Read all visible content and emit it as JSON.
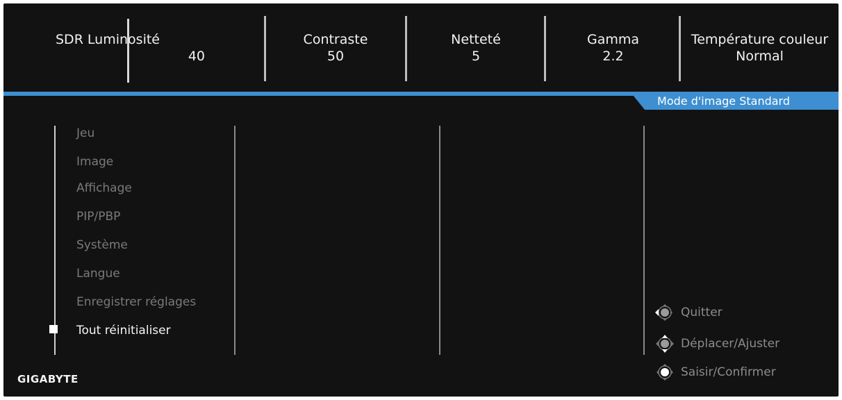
{
  "status": [
    {
      "label": "SDR Luminosité",
      "value": "40"
    },
    {
      "label": "Contraste",
      "value": "50"
    },
    {
      "label": "Netteté",
      "value": "5"
    },
    {
      "label": "Gamma",
      "value": "2.2"
    },
    {
      "label": "Température couleur",
      "value": "Normal"
    }
  ],
  "mode_label": "Mode d'image Standard",
  "menu": {
    "items": [
      "Jeu",
      "Image",
      "Affichage",
      "PIP/PBP",
      "Système",
      "Langue",
      "Enregistrer réglages",
      "Tout réinitialiser"
    ],
    "active_index": 7
  },
  "hints": [
    {
      "icon": "joystick-left-icon",
      "label": "Quitter"
    },
    {
      "icon": "joystick-move-icon",
      "label": "Déplacer/Ajuster"
    },
    {
      "icon": "joystick-press-icon",
      "label": "Saisir/Confirmer"
    }
  ],
  "brand": "GIGABYTE",
  "colors": {
    "background": "#121212",
    "accent": "#3d8fd1",
    "text_active": "#f5f5f5",
    "text_inactive": "#7a7a7a"
  }
}
